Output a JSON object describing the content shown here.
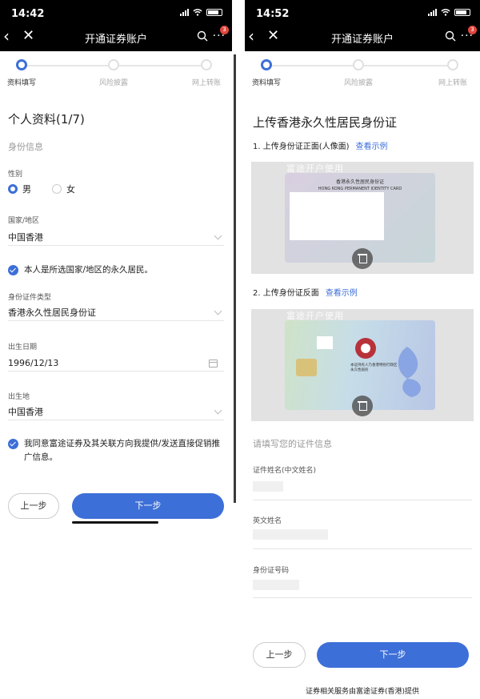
{
  "left": {
    "status_time": "14:42",
    "nav_title": "开通证券账户",
    "badge": "3",
    "steps": [
      "资料填写",
      "风险披露",
      "网上转账"
    ],
    "page_title": "个人资料(1/7)",
    "section": "身份信息",
    "gender_label": "性别",
    "gender_options": [
      "男",
      "女"
    ],
    "country_label": "国家/地区",
    "country_value": "中国香港",
    "permanent_resident_text": "本人是所选国家/地区的永久居民。",
    "id_type_label": "身份证件类型",
    "id_type_value": "香港永久性居民身份证",
    "dob_label": "出生日期",
    "dob_value": "1996/12/13",
    "birthplace_label": "出生地",
    "birthplace_value": "中国香港",
    "consent_text": "我同意富途证券及其关联方向我提供/发送直接促销推广信息。",
    "prev_button": "上一步",
    "next_button": "下一步"
  },
  "right": {
    "status_time": "14:52",
    "nav_title": "开通证券账户",
    "badge": "3",
    "steps": [
      "资料填写",
      "风险披露",
      "网上转账"
    ],
    "page_title": "上传香港永久性居民身份证",
    "upload_front_label": "1. 上传身份证正面(人像面)",
    "upload_back_label": "2. 上传身份证反面",
    "view_example": "查看示例",
    "watermark": "富途开户使用",
    "card_front_title": "香港永久性居民身份证",
    "card_front_subtitle": "HONG KONG PERMANENT IDENTITY CARD",
    "card_back_text": "本证持有人乃香港特别行政区永久性居民",
    "info_prompt": "请填写您的证件信息",
    "name_cn_label": "证件姓名(中文姓名)",
    "name_en_label": "英文姓名",
    "id_number_label": "身份证号码",
    "prev_button": "上一步",
    "next_button": "下一步",
    "footer": "证券相关服务由富途证券(香港)提供"
  },
  "colors": {
    "accent": "#3d6fd8",
    "topbar": "#000000",
    "badge": "#e0473d"
  }
}
